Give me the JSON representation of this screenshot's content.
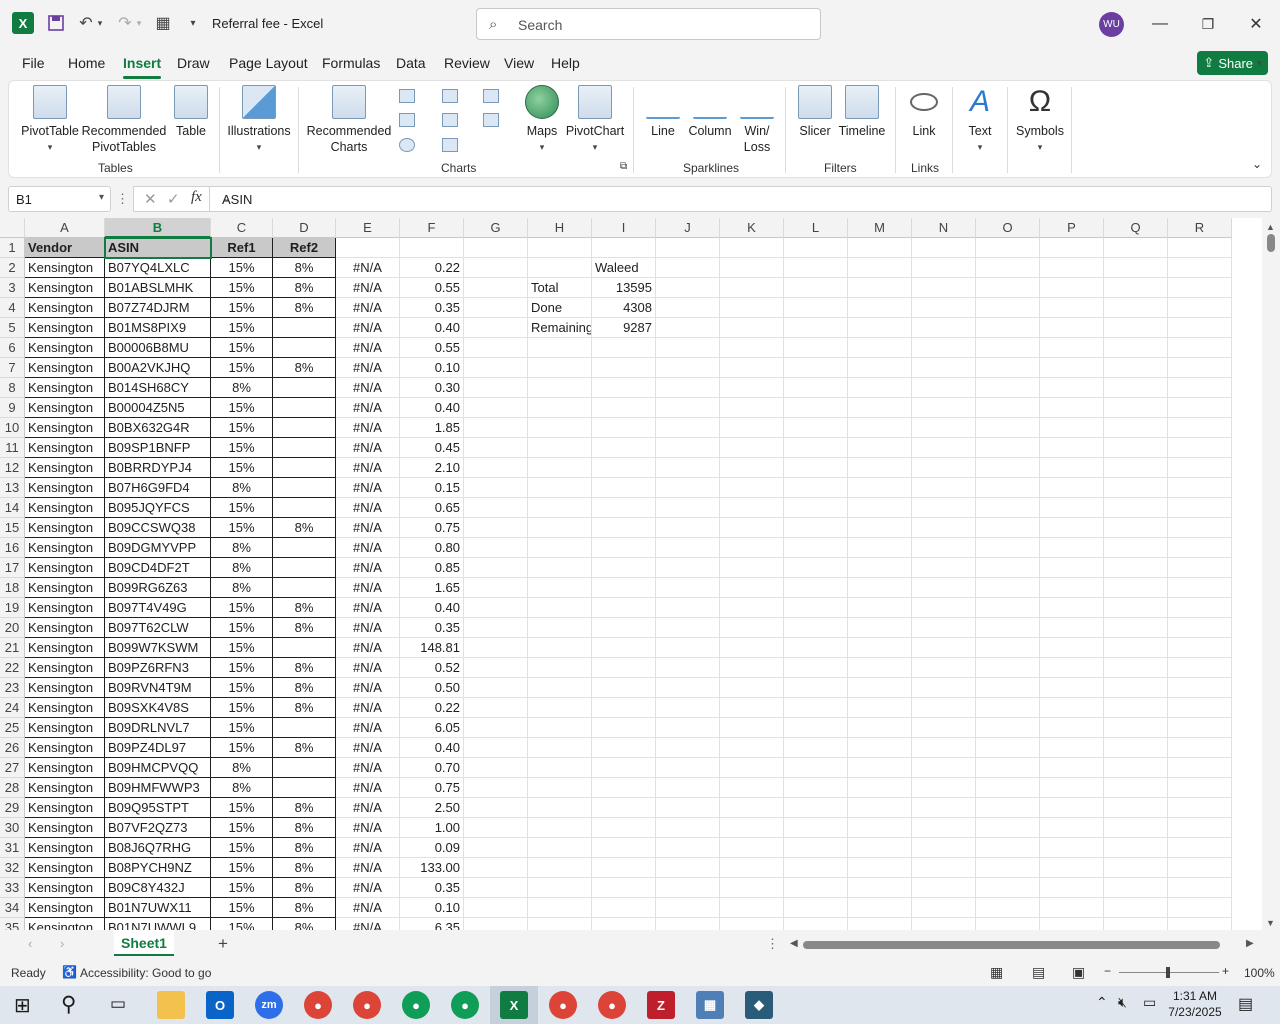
{
  "window": {
    "doc_title": "Referral fee  -  Excel",
    "search_placeholder": "Search",
    "avatar_initials": "WU",
    "share_label": "Share"
  },
  "menu": [
    "File",
    "Home",
    "Insert",
    "Draw",
    "Page Layout",
    "Formulas",
    "Data",
    "Review",
    "View",
    "Help"
  ],
  "active_tab": "Insert",
  "ribbon": {
    "pivottable": "PivotTable",
    "recommended_pivot_1": "Recommended",
    "recommended_pivot_2": "PivotTables",
    "table": "Table",
    "illustrations": "Illustrations",
    "recommended_charts_1": "Recommended",
    "recommended_charts_2": "Charts",
    "maps": "Maps",
    "pivotchart": "PivotChart",
    "line": "Line",
    "column": "Column",
    "winloss_1": "Win/",
    "winloss_2": "Loss",
    "slicer": "Slicer",
    "timeline": "Timeline",
    "link": "Link",
    "text": "Text",
    "symbols": "Symbols",
    "groups": {
      "tables": "Tables",
      "charts": "Charts",
      "sparklines": "Sparklines",
      "filters": "Filters",
      "links": "Links"
    }
  },
  "formula_bar": {
    "name_box": "B1",
    "formula": "ASIN"
  },
  "columns": [
    "A",
    "B",
    "C",
    "D",
    "E",
    "F",
    "G",
    "H",
    "I",
    "J",
    "K",
    "L",
    "M",
    "N",
    "O",
    "P",
    "Q",
    "R"
  ],
  "selected_column": "B",
  "header_row": [
    "Vendor",
    "ASIN",
    "Ref1",
    "Ref2"
  ],
  "rows": [
    [
      "Kensington",
      "B07YQ4LXLC",
      "15%",
      "8%",
      "#N/A",
      "0.22"
    ],
    [
      "Kensington",
      "B01ABSLMHK",
      "15%",
      "8%",
      "#N/A",
      "0.55"
    ],
    [
      "Kensington",
      "B07Z74DJRM",
      "15%",
      "8%",
      "#N/A",
      "0.35"
    ],
    [
      "Kensington",
      "B01MS8PIX9",
      "15%",
      "",
      "#N/A",
      "0.40"
    ],
    [
      "Kensington",
      "B00006B8MU",
      "15%",
      "",
      "#N/A",
      "0.55"
    ],
    [
      "Kensington",
      "B00A2VKJHQ",
      "15%",
      "8%",
      "#N/A",
      "0.10"
    ],
    [
      "Kensington",
      "B014SH68CY",
      "8%",
      "",
      "#N/A",
      "0.30"
    ],
    [
      "Kensington",
      "B00004Z5N5",
      "15%",
      "",
      "#N/A",
      "0.40"
    ],
    [
      "Kensington",
      "B0BX632G4R",
      "15%",
      "",
      "#N/A",
      "1.85"
    ],
    [
      "Kensington",
      "B09SP1BNFP",
      "15%",
      "",
      "#N/A",
      "0.45"
    ],
    [
      "Kensington",
      "B0BRRDYPJ4",
      "15%",
      "",
      "#N/A",
      "2.10"
    ],
    [
      "Kensington",
      "B07H6G9FD4",
      "8%",
      "",
      "#N/A",
      "0.15"
    ],
    [
      "Kensington",
      "B095JQYFCS",
      "15%",
      "",
      "#N/A",
      "0.65"
    ],
    [
      "Kensington",
      "B09CCSWQ38",
      "15%",
      "8%",
      "#N/A",
      "0.75"
    ],
    [
      "Kensington",
      "B09DGMYVPP",
      "8%",
      "",
      "#N/A",
      "0.80"
    ],
    [
      "Kensington",
      "B09CD4DF2T",
      "8%",
      "",
      "#N/A",
      "0.85"
    ],
    [
      "Kensington",
      "B099RG6Z63",
      "8%",
      "",
      "#N/A",
      "1.65"
    ],
    [
      "Kensington",
      "B097T4V49G",
      "15%",
      "8%",
      "#N/A",
      "0.40"
    ],
    [
      "Kensington",
      "B097T62CLW",
      "15%",
      "8%",
      "#N/A",
      "0.35"
    ],
    [
      "Kensington",
      "B099W7KSWM",
      "15%",
      "",
      "#N/A",
      "148.81"
    ],
    [
      "Kensington",
      "B09PZ6RFN3",
      "15%",
      "8%",
      "#N/A",
      "0.52"
    ],
    [
      "Kensington",
      "B09RVN4T9M",
      "15%",
      "8%",
      "#N/A",
      "0.50"
    ],
    [
      "Kensington",
      "B09SXK4V8S",
      "15%",
      "8%",
      "#N/A",
      "0.22"
    ],
    [
      "Kensington",
      "B09DRLNVL7",
      "15%",
      "",
      "#N/A",
      "6.05"
    ],
    [
      "Kensington",
      "B09PZ4DL97",
      "15%",
      "8%",
      "#N/A",
      "0.40"
    ],
    [
      "Kensington",
      "B09HMCPVQQ",
      "8%",
      "",
      "#N/A",
      "0.70"
    ],
    [
      "Kensington",
      "B09HMFWWP3",
      "8%",
      "",
      "#N/A",
      "0.75"
    ],
    [
      "Kensington",
      "B09Q95STPT",
      "15%",
      "8%",
      "#N/A",
      "2.50"
    ],
    [
      "Kensington",
      "B07VF2QZ73",
      "15%",
      "8%",
      "#N/A",
      "1.00"
    ],
    [
      "Kensington",
      "B08J6Q7RHG",
      "15%",
      "8%",
      "#N/A",
      "0.09"
    ],
    [
      "Kensington",
      "B08PYCH9NZ",
      "15%",
      "8%",
      "#N/A",
      "133.00"
    ],
    [
      "Kensington",
      "B09C8Y432J",
      "15%",
      "8%",
      "#N/A",
      "0.35"
    ],
    [
      "Kensington",
      "B01N7UWX11",
      "15%",
      "8%",
      "#N/A",
      "0.10"
    ],
    [
      "Kensington",
      "B01N7UWWL9",
      "15%",
      "8%",
      "#N/A",
      "6.35"
    ]
  ],
  "summary": {
    "name": "Waleed",
    "total_label": "Total",
    "total_value": "13595",
    "done_label": "Done",
    "done_value": "4308",
    "remaining_label": "Remaining",
    "remaining_value": "9287"
  },
  "sheet_tabs": [
    "Sheet1"
  ],
  "status": {
    "ready": "Ready",
    "accessibility": "Accessibility: Good to go",
    "zoom": "100%"
  },
  "clock": {
    "time": "1:31 AM",
    "date": "7/23/2025"
  },
  "colors": {
    "excel_green": "#107c41",
    "header_fill": "#c9c9c9"
  }
}
